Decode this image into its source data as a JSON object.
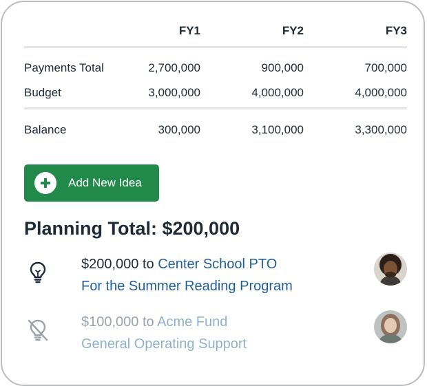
{
  "budget_table": {
    "columns": [
      "",
      "FY1",
      "FY2",
      "FY3"
    ],
    "rows": [
      {
        "label": "Payments Total",
        "values": [
          "2,700,000",
          "900,000",
          "700,000"
        ]
      },
      {
        "label": "Budget",
        "values": [
          "3,000,000",
          "4,000,000",
          "4,000,000"
        ]
      }
    ],
    "balance": {
      "label": "Balance",
      "values": [
        "300,000",
        "3,100,000",
        "3,300,000"
      ]
    }
  },
  "add_button": {
    "label": "Add New Idea",
    "icon": "plus-circle-icon"
  },
  "planning_total": "Planning Total: $200,000",
  "ideas": [
    {
      "amount": "$200,000",
      "connector": "to",
      "organization": "Center School PTO",
      "purpose": "For the Summer Reading Program",
      "icon": "lightbulb-icon",
      "status": "active"
    },
    {
      "amount": "$100,000",
      "connector": "to",
      "organization": "Acme Fund",
      "purpose": "General Operating Support",
      "icon": "lightbulb-off-icon",
      "status": "inactive"
    }
  ],
  "colors": {
    "accent_green": "#218a4a",
    "link_blue": "#1f5e9a",
    "link_blue_dim": "#8fb0cc",
    "text_dark": "#1f2a37",
    "text_muted": "#9aa3ab"
  }
}
